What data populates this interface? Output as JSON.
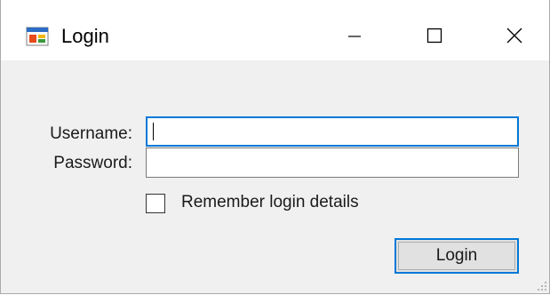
{
  "window": {
    "title": "Login",
    "icon": "windows-form-icon",
    "controls": {
      "minimize": "minimize-icon",
      "maximize": "maximize-icon",
      "close": "close-icon"
    }
  },
  "form": {
    "username_label": "Username:",
    "username_value": "",
    "password_label": "Password:",
    "password_value": "",
    "remember_label": "Remember login details",
    "remember_checked": false,
    "login_button_label": "Login"
  },
  "colors": {
    "focus_accent": "#0078d7",
    "window_bg": "#f0f0f0",
    "titlebar_bg": "#ffffff"
  }
}
